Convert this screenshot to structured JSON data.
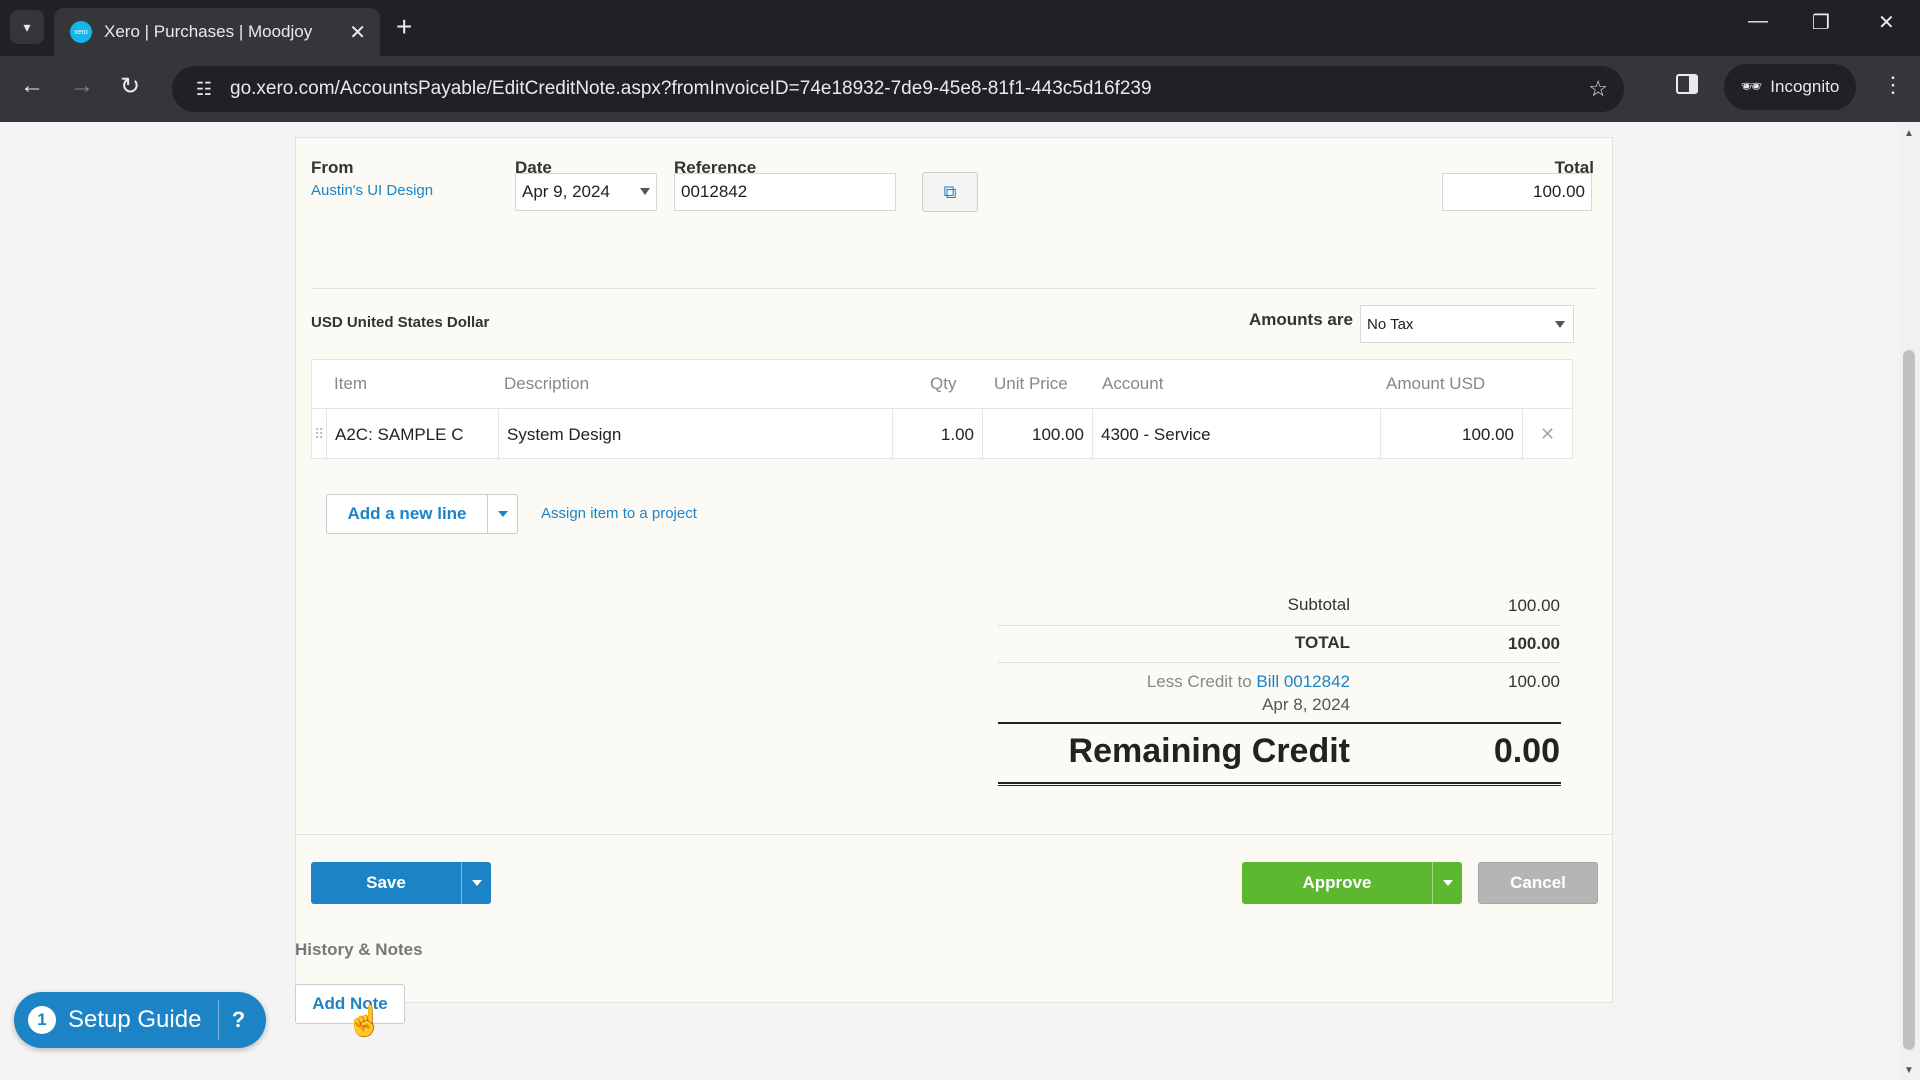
{
  "browser": {
    "tab_title": "Xero | Purchases | Moodjoy",
    "tab_favicon_text": "xero",
    "url": "go.xero.com/AccountsPayable/EditCreditNote.aspx?fromInvoiceID=74e18932-7de9-45e8-81f1-443c5d16f239",
    "incognito_label": "Incognito"
  },
  "form": {
    "from_label": "From",
    "from_value": "Austin's UI Design",
    "date_label": "Date",
    "date_value": "Apr 9, 2024",
    "reference_label": "Reference",
    "reference_value": "0012842",
    "total_label": "Total",
    "total_value": "100.00",
    "currency": "USD United States Dollar",
    "amounts_are_label": "Amounts are",
    "amounts_are_value": "No Tax"
  },
  "table": {
    "headers": {
      "item": "Item",
      "description": "Description",
      "qty": "Qty",
      "unit_price": "Unit Price",
      "account": "Account",
      "amount": "Amount USD"
    },
    "rows": [
      {
        "item": "A2C: SAMPLE C",
        "description": "System Design",
        "qty": "1.00",
        "unit_price": "100.00",
        "account": "4300 - Service",
        "amount": "100.00"
      }
    ],
    "add_line_label": "Add a new line",
    "assign_label": "Assign item to a project"
  },
  "summary": {
    "subtotal_label": "Subtotal",
    "subtotal_value": "100.00",
    "total_label": "TOTAL",
    "total_value": "100.00",
    "less_credit_prefix": "Less Credit to",
    "less_credit_link": "Bill 0012842",
    "less_credit_date": "Apr 8, 2024",
    "less_credit_value": "100.00",
    "remaining_label": "Remaining Credit",
    "remaining_value": "0.00"
  },
  "actions": {
    "save": "Save",
    "approve": "Approve",
    "cancel": "Cancel"
  },
  "history": {
    "title": "History & Notes",
    "add_note": "Add Note"
  },
  "setup_guide": {
    "count": "1",
    "label": "Setup Guide"
  },
  "colors": {
    "xero_blue": "#1c84c6",
    "approve_green": "#5cb82e",
    "cancel_grey": "#b5b5b5"
  }
}
